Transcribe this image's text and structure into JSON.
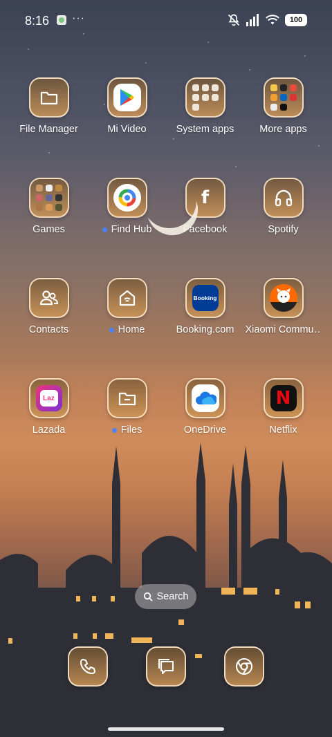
{
  "status_bar": {
    "time": "8:16",
    "more_indicator": "···",
    "battery": "100",
    "icons": [
      "notification-app-icon",
      "mute-icon",
      "signal-icon",
      "wifi-icon",
      "battery-icon"
    ]
  },
  "apps": [
    {
      "label": "File Manager",
      "icon": "folder-icon",
      "badge": false
    },
    {
      "label": "Mi Video",
      "icon": "play-icon",
      "badge": false
    },
    {
      "label": "System apps",
      "icon": "folder-grid-icon",
      "badge": false
    },
    {
      "label": "More apps",
      "icon": "folder-grid-icon",
      "badge": false
    },
    {
      "label": "Games",
      "icon": "folder-grid-icon",
      "badge": false
    },
    {
      "label": "Find Hub",
      "icon": "find-hub-icon",
      "badge": true
    },
    {
      "label": "Facebook",
      "icon": "facebook-icon",
      "badge": false
    },
    {
      "label": "Spotify",
      "icon": "headphones-icon",
      "badge": false
    },
    {
      "label": "Contacts",
      "icon": "contacts-icon",
      "badge": false
    },
    {
      "label": "Home",
      "icon": "home-icon",
      "badge": true
    },
    {
      "label": "Booking.com",
      "icon": "booking-icon",
      "badge": false
    },
    {
      "label": "Xiaomi Commu…",
      "icon": "xiaomi-community-icon",
      "badge": false
    },
    {
      "label": "Lazada",
      "icon": "lazada-icon",
      "badge": false
    },
    {
      "label": "Files",
      "icon": "files-icon",
      "badge": true
    },
    {
      "label": "OneDrive",
      "icon": "onedrive-icon",
      "badge": false
    },
    {
      "label": "Netflix",
      "icon": "netflix-icon",
      "badge": false
    }
  ],
  "app_icon_text": {
    "booking": "Booking",
    "lazada": "Laz",
    "netflix": "N",
    "facebook": "f"
  },
  "search": {
    "label": "Search"
  },
  "dock": [
    {
      "icon": "phone-icon"
    },
    {
      "icon": "messages-icon"
    },
    {
      "icon": "chrome-icon"
    }
  ],
  "colors": {
    "badge_dot": "#4a82ff",
    "tile_border": "#ffecd2",
    "netflix_red": "#e50914",
    "booking_blue": "#003b95",
    "lazada_pink": "#f0337c"
  }
}
